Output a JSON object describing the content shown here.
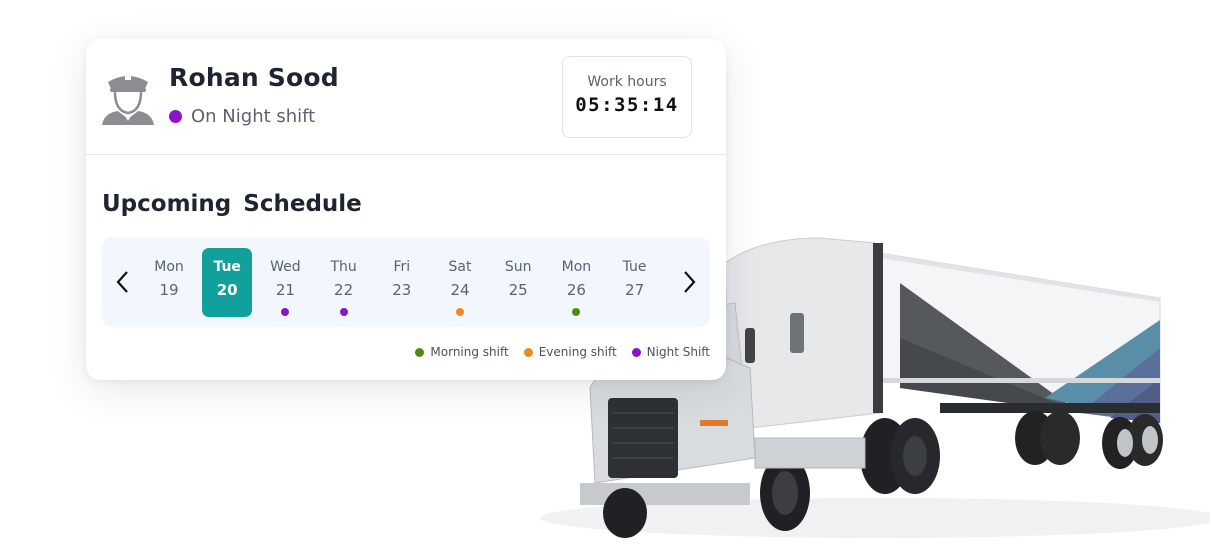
{
  "driver": {
    "name": "Rohan Sood",
    "status": "On Night shift",
    "status_color": "#8a16c9",
    "avatar_icon": "driver-avatar-icon"
  },
  "work_hours": {
    "label": "Work hours",
    "value": "05:35:14"
  },
  "schedule": {
    "title": "Upcoming  Schedule",
    "prev_icon": "chevron-left-icon",
    "next_icon": "chevron-right-icon",
    "selected_index": 1,
    "days": [
      {
        "day": "Mon",
        "date": "19",
        "shift": null
      },
      {
        "day": "Tue",
        "date": "20",
        "shift": null
      },
      {
        "day": "Wed",
        "date": "21",
        "shift": "night"
      },
      {
        "day": "Thu",
        "date": "22",
        "shift": "night"
      },
      {
        "day": "Fri",
        "date": "23",
        "shift": null
      },
      {
        "day": "Sat",
        "date": "24",
        "shift": "evening"
      },
      {
        "day": "Sun",
        "date": "25",
        "shift": null
      },
      {
        "day": "Mon",
        "date": "26",
        "shift": "morning"
      },
      {
        "day": "Tue",
        "date": "27",
        "shift": null
      }
    ]
  },
  "legend": [
    {
      "key": "morning",
      "label": "Morning shift",
      "color": "#4e8a12"
    },
    {
      "key": "evening",
      "label": "Evening shift",
      "color": "#ec8a22"
    },
    {
      "key": "night",
      "label": "Night Shift",
      "color": "#8a16c9"
    }
  ],
  "colors": {
    "accent": "#12a09c",
    "calendar_bg": "#f2f7fd"
  }
}
